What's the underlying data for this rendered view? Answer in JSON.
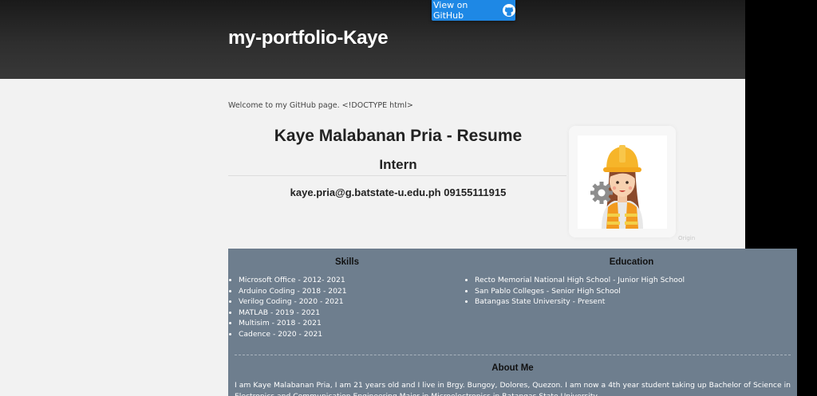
{
  "header": {
    "site_title": "my-portfolio-Kaye",
    "github_button": {
      "label": "View on GitHub",
      "icon": "github-icon"
    }
  },
  "main": {
    "welcome": "Welcome to my GitHub page. <!DOCTYPE html>",
    "resume_title": "Kaye Malabanan Pria - Resume",
    "role": "Intern",
    "contact": "kaye.pria@g.batstate-u.edu.ph 09155111915",
    "avatar_caption": "Origin"
  },
  "skills": {
    "title": "Skills",
    "items": [
      "Microsoft Office - 2012- 2021",
      "Arduino Coding - 2018 - 2021",
      "Verilog Coding - 2020 - 2021",
      "MATLAB - 2019 - 2021",
      "Multisim - 2018 - 2021",
      "Cadence - 2020 - 2021"
    ]
  },
  "education": {
    "title": "Education",
    "items": [
      "Recto Memorial National High School - Junior High School",
      "San Pablo Colleges - Senior High School",
      "Batangas State University - Present"
    ]
  },
  "about": {
    "title": "About Me",
    "text": "I am Kaye Malabanan Pria, I am 21 years old and I live in Brgy. Bungoy, Dolores, Quezon. I am now a 4th year student taking up Bachelor of Science in Electronics and Communication Engineering Major in Microelectronics in Batangas State University."
  },
  "colors": {
    "header_bg": "#2a2a2a",
    "accent_button": "#1e88e5",
    "panel_bg": "#6e7e8e",
    "page_bg": "#f2f2f2"
  }
}
